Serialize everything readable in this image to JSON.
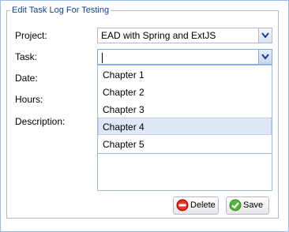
{
  "panel": {
    "title": "Edit Task Log For Testing"
  },
  "form": {
    "project_label": "Project:",
    "project_value": "EAD with Spring and ExtJS",
    "task_label": "Task:",
    "task_value": "",
    "date_label": "Date:",
    "hours_label": "Hours:",
    "description_label": "Description:"
  },
  "task_dropdown": {
    "options": [
      "Chapter 1",
      "Chapter 2",
      "Chapter 3",
      "Chapter 4",
      "Chapter 5"
    ],
    "highlighted": "Chapter 4"
  },
  "buttons": {
    "delete_label": "Delete",
    "save_label": "Save"
  },
  "icons": {
    "delete": "delete-icon",
    "save": "check-icon",
    "trigger": "chevron-down-icon"
  },
  "colors": {
    "border": "#99bbe8",
    "legend_text": "#15428b",
    "highlight": "#dfe8f6",
    "delete_icon": "#cc0000",
    "save_icon": "#3a9a2a"
  }
}
